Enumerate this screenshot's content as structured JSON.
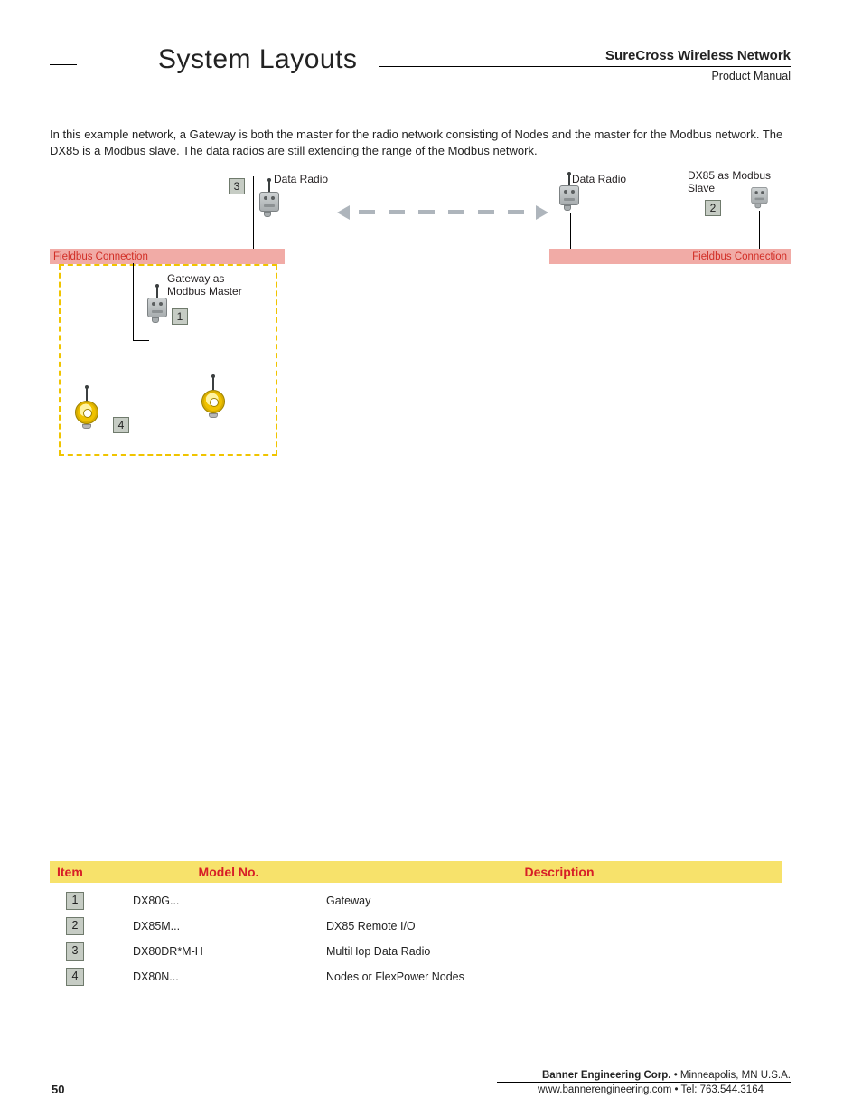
{
  "header": {
    "section_title": "System Layouts",
    "doc_title": "SureCross Wireless Network",
    "doc_subtitle": "Product Manual"
  },
  "intro": "In this example network, a Gateway is both the master for the radio network consisting of Nodes and the master for the Modbus network. The DX85 is a Modbus slave. The data radios are still extending the range of the Modbus network.",
  "diagram": {
    "labels": {
      "data_radio_left": "Data Radio",
      "data_radio_right": "Data Radio",
      "dx85_slave": "DX85 as Modbus Slave",
      "fieldbus_left": "Fieldbus Connection",
      "fieldbus_right": "Fieldbus Connection",
      "gateway_master": "Gateway as Modbus Master"
    },
    "numbers": {
      "n1": "1",
      "n2": "2",
      "n3": "3",
      "n4": "4"
    }
  },
  "table": {
    "headers": {
      "item": "Item",
      "model": "Model No.",
      "desc": "Description"
    },
    "rows": [
      {
        "n": "1",
        "model": "DX80G...",
        "desc": "Gateway"
      },
      {
        "n": "2",
        "model": "DX85M...",
        "desc": "DX85 Remote I/O"
      },
      {
        "n": "3",
        "model": "DX80DR*M-H",
        "desc": "MultiHop Data Radio"
      },
      {
        "n": "4",
        "model": "DX80N...",
        "desc": "Nodes or FlexPower Nodes"
      }
    ]
  },
  "footer": {
    "page": "50",
    "company_bold": "Banner Engineering Corp.",
    "company_rest": " • Minneapolis, MN U.S.A.",
    "contact": "www.bannerengineering.com  •  Tel: 763.544.3164"
  }
}
